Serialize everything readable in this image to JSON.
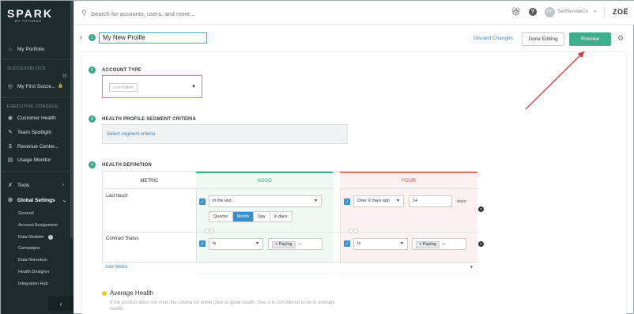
{
  "sidebar": {
    "logo": "SPARK",
    "logo_sub": "BY TOTANGO",
    "portfolio": "My Portfolio",
    "successblocs_label": "SUCCESSBLOCS",
    "first_success": "My First Succe...",
    "exec_label": "EXECUTIVE CONSOLE",
    "items": [
      {
        "label": "Customer Health"
      },
      {
        "label": "Team Spotlight"
      },
      {
        "label": "Revenue Center..."
      },
      {
        "label": "Usage Monitor"
      }
    ],
    "tools": "Tools",
    "global_settings": "Global Settings",
    "sub_items": [
      {
        "label": "General"
      },
      {
        "label": "Account Assignment"
      },
      {
        "label": "Data Modeler"
      },
      {
        "label": "Campaigns"
      },
      {
        "label": "Data Retention"
      },
      {
        "label": "Health Designer"
      },
      {
        "label": "Integration Hub"
      }
    ],
    "collapse": "‹"
  },
  "topbar": {
    "search_placeholder": "Search for accounts, users, and more...",
    "avatar": "PP",
    "tenant": "SelfServiceCo.",
    "brand": "ZOË"
  },
  "header": {
    "step1": "1",
    "profile_name": "My New Proifle",
    "discard": "Discard Changes",
    "done": "Done Editing",
    "preview": "Preview"
  },
  "account_type": {
    "step": "2",
    "title": "ACCOUNT TYPE",
    "chip": "CUSTOMER"
  },
  "segment": {
    "step": "3",
    "title": "HEALTH PROFILE SEGMENT CRITERIA",
    "link": "Select segment criteria"
  },
  "health": {
    "step": "4",
    "title": "HEALTH DEFINITION",
    "col_metric": "METRIC",
    "col_good": "GOOD",
    "col_poor": "POOR",
    "rows": [
      {
        "metric": "Last touch",
        "good_select": "in the last...",
        "poor_select": "Over X days ago",
        "poor_value": "14",
        "poor_unit": "days"
      },
      {
        "metric": "Contract Status",
        "good_select": "Is",
        "good_tag": "Paying",
        "good_or": "or",
        "poor_select": "Is",
        "poor_tag": "Paying",
        "poor_or": "or"
      }
    ],
    "periods": [
      "Quarter",
      "Month",
      "Day",
      "X days"
    ],
    "or_pill": "or",
    "add_metric": "Add Metric"
  },
  "average": {
    "title": "Average Health",
    "desc": "If the product does not meet the criteria for either poor or good health, then it is considered to be in average health."
  },
  "colors": {
    "sidebar_bg": "#1d2b2d",
    "accent_green": "#3fae8a",
    "link_blue": "#3a82c4",
    "poor_red": "#e0605d",
    "annotation_arrow": "#d93a3a"
  }
}
